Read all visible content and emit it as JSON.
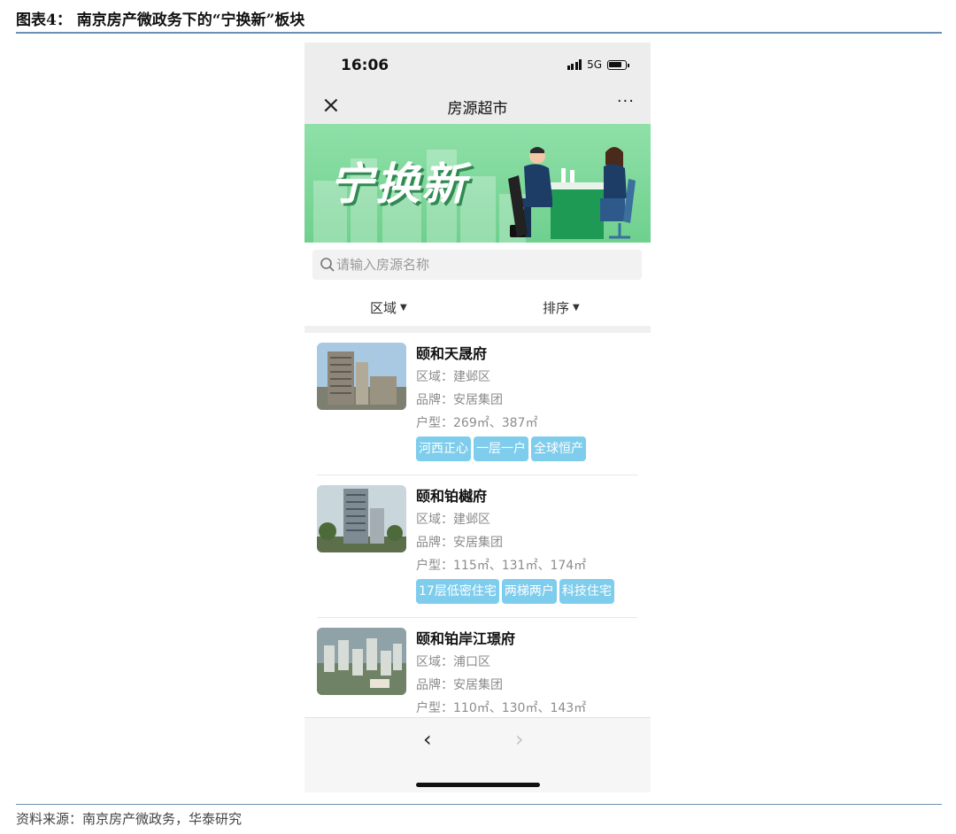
{
  "figure": {
    "title": "图表4： 南京房产微政务下的“宁换新”板块",
    "source": "资料来源：南京房产微政务，华泰研究"
  },
  "status_bar": {
    "time": "16:06",
    "network": "5G"
  },
  "nav": {
    "close_label": "×",
    "title": "房源超市",
    "more_label": "···"
  },
  "banner": {
    "text": "宁换新"
  },
  "search": {
    "placeholder": "请输入房源名称"
  },
  "filters": {
    "region_label": "区域",
    "sort_label": "排序"
  },
  "listings": [
    {
      "name": "颐和天晟府",
      "district": "区域：建邺区",
      "brand": "品牌：安居集团",
      "layout": "户型：269㎡、387㎡",
      "tags": [
        "河西正心",
        "一层一户",
        "全球恒产"
      ]
    },
    {
      "name": "颐和铂樾府",
      "district": "区域：建邺区",
      "brand": "品牌：安居集团",
      "layout": "户型：115㎡、131㎡、174㎡",
      "tags": [
        "17层低密住宅",
        "两梯两户",
        "科技住宅"
      ]
    },
    {
      "name": "颐和铂岸江璟府",
      "district": "区域：浦口区",
      "brand": "品牌：安居集团",
      "layout": "户型：110㎡、130㎡、143㎡"
    }
  ],
  "bottom_nav": {
    "back_label": "‹",
    "forward_label": "›"
  },
  "colors": {
    "banner_green": "#7ad89a",
    "tag_blue": "#7fcdec",
    "bar_gray": "#ededed",
    "rule_blue": "#6b8fb3"
  }
}
